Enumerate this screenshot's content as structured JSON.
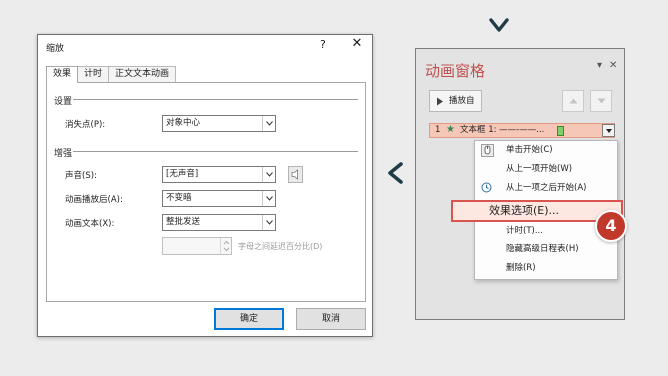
{
  "dialog": {
    "title": "缩放",
    "help": "?",
    "close": "✕",
    "tabs": [
      "效果",
      "计时",
      "正文文本动画"
    ],
    "settings_heading": "设置",
    "vanish_label": "消失点(P):",
    "vanish_value": "对象中心",
    "enhance_heading": "增强",
    "sound_label": "声音(S):",
    "sound_value": "[无声音]",
    "after_label": "动画播放后(A):",
    "after_value": "不变暗",
    "text_label": "动画文本(X):",
    "text_value": "整批发送",
    "delay_hint": "字母之间延迟百分比(D)",
    "ok": "确定",
    "cancel": "取消"
  },
  "pane": {
    "title": "动画窗格",
    "dropdown_ctrl": "▾",
    "close_ctrl": "✕",
    "play_label": "播放自",
    "item": {
      "number": "1",
      "star": "★",
      "name": "文本框 1: ——-——..."
    }
  },
  "menu": {
    "items": [
      "单击开始(C)",
      "从上一项开始(W)",
      "从上一项之后开始(A)",
      "效果选项(E)...",
      "计时(T)...",
      "隐藏高级日程表(H)",
      "删除(R)"
    ]
  },
  "badge": "4",
  "colors": {
    "accent_red": "#c0504d",
    "highlight_border": "#d9534f",
    "badge": "#c0392b",
    "chevron": "#1f3b45"
  }
}
